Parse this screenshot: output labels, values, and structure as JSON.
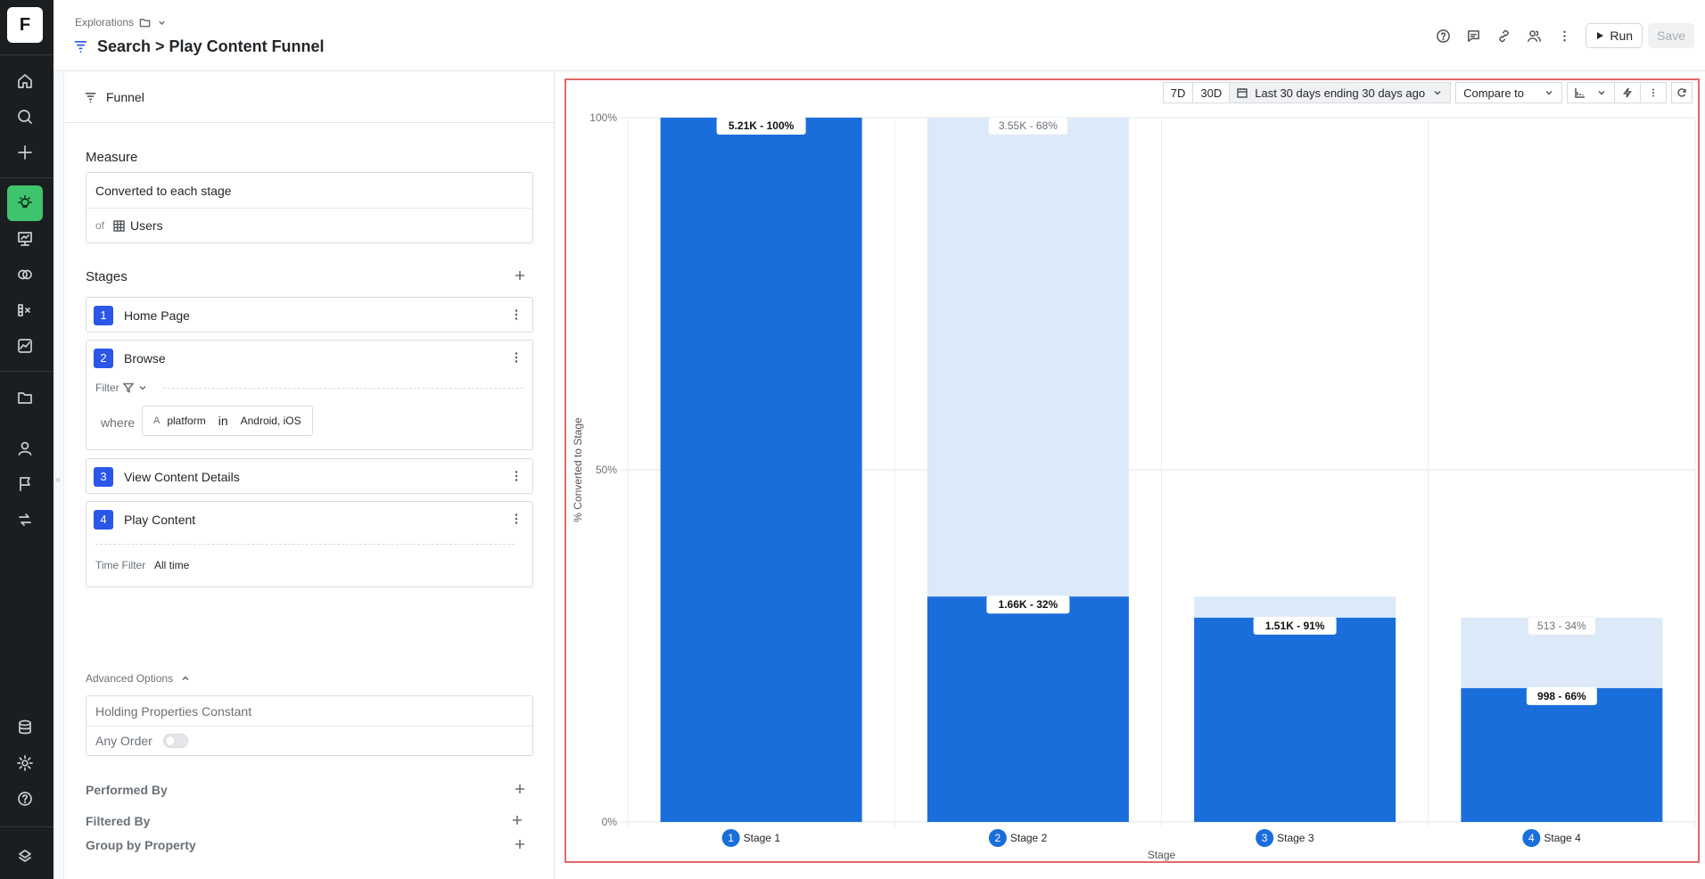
{
  "app": {
    "logo": "F"
  },
  "rail": {
    "top_items": [
      "home-icon",
      "search-icon",
      "plus-icon"
    ],
    "mid_items": [
      "lightbulb-icon",
      "presentation-icon",
      "overlap-icon",
      "formula-icon",
      "trend-chart-icon"
    ],
    "lower_items": [
      "folder-icon",
      "user-icon",
      "flag-icon",
      "transfer-icon"
    ],
    "bottom_items": [
      "database-icon",
      "gear-icon",
      "help-icon",
      "brand-icon"
    ],
    "active": "lightbulb-icon",
    "active_color": "#3ec46d"
  },
  "header": {
    "breadcrumb": "Explorations",
    "title": "Search > Play Content Funnel",
    "run_label": "Run",
    "save_label": "Save"
  },
  "panel": {
    "type_label": "Funnel",
    "measure_label": "Measure",
    "measure_value": "Converted to each stage",
    "of_label": "of",
    "entity": "Users",
    "stages_label": "Stages",
    "stages": [
      {
        "number": "1",
        "name": "Home Page"
      },
      {
        "number": "2",
        "name": "Browse"
      },
      {
        "number": "3",
        "name": "View Content Details"
      },
      {
        "number": "4",
        "name": "Play Content"
      }
    ],
    "filter_label": "Filter",
    "where_label": "where",
    "filter_property": "platform",
    "filter_operator": "in",
    "filter_values": "Android, iOS",
    "time_filter_label": "Time Filter",
    "time_filter_value": "All time",
    "advanced_label": "Advanced Options",
    "holding_placeholder": "Holding Properties Constant",
    "any_order_label": "Any Order",
    "any_order_on": false,
    "performed_by_label": "Performed By",
    "group_by_label": "Group by Property",
    "filtered_by_label": "Filtered By"
  },
  "toolbar": {
    "btn_7d": "7D",
    "btn_30d": "30D",
    "date_range": "Last 30 days ending 30 days ago",
    "compare_label": "Compare to"
  },
  "chart_data": {
    "type": "bar",
    "stacked": true,
    "categories": [
      "Stage 1",
      "Stage 2",
      "Stage 3",
      "Stage 4"
    ],
    "category_numbers": [
      "1",
      "2",
      "3",
      "4"
    ],
    "series": [
      {
        "name": "converted",
        "values": [
          100,
          32,
          29,
          19
        ],
        "labels": [
          "5.21K - 100%",
          "1.66K - 32%",
          "1.51K - 91%",
          "998 - 66%"
        ]
      },
      {
        "name": "dropped",
        "values": [
          0,
          68,
          3,
          10
        ],
        "labels": [
          "",
          "3.55K - 68%",
          "",
          "513 - 34%"
        ]
      }
    ],
    "xlabel": "Stage",
    "ylabel": "% Converted to Stage",
    "ylim": [
      0,
      100
    ],
    "yticks": [
      "0%",
      "50%",
      "100%"
    ],
    "colors": {
      "converted": "#1a6edb",
      "dropped": "#dce9f8"
    },
    "grid": true
  }
}
